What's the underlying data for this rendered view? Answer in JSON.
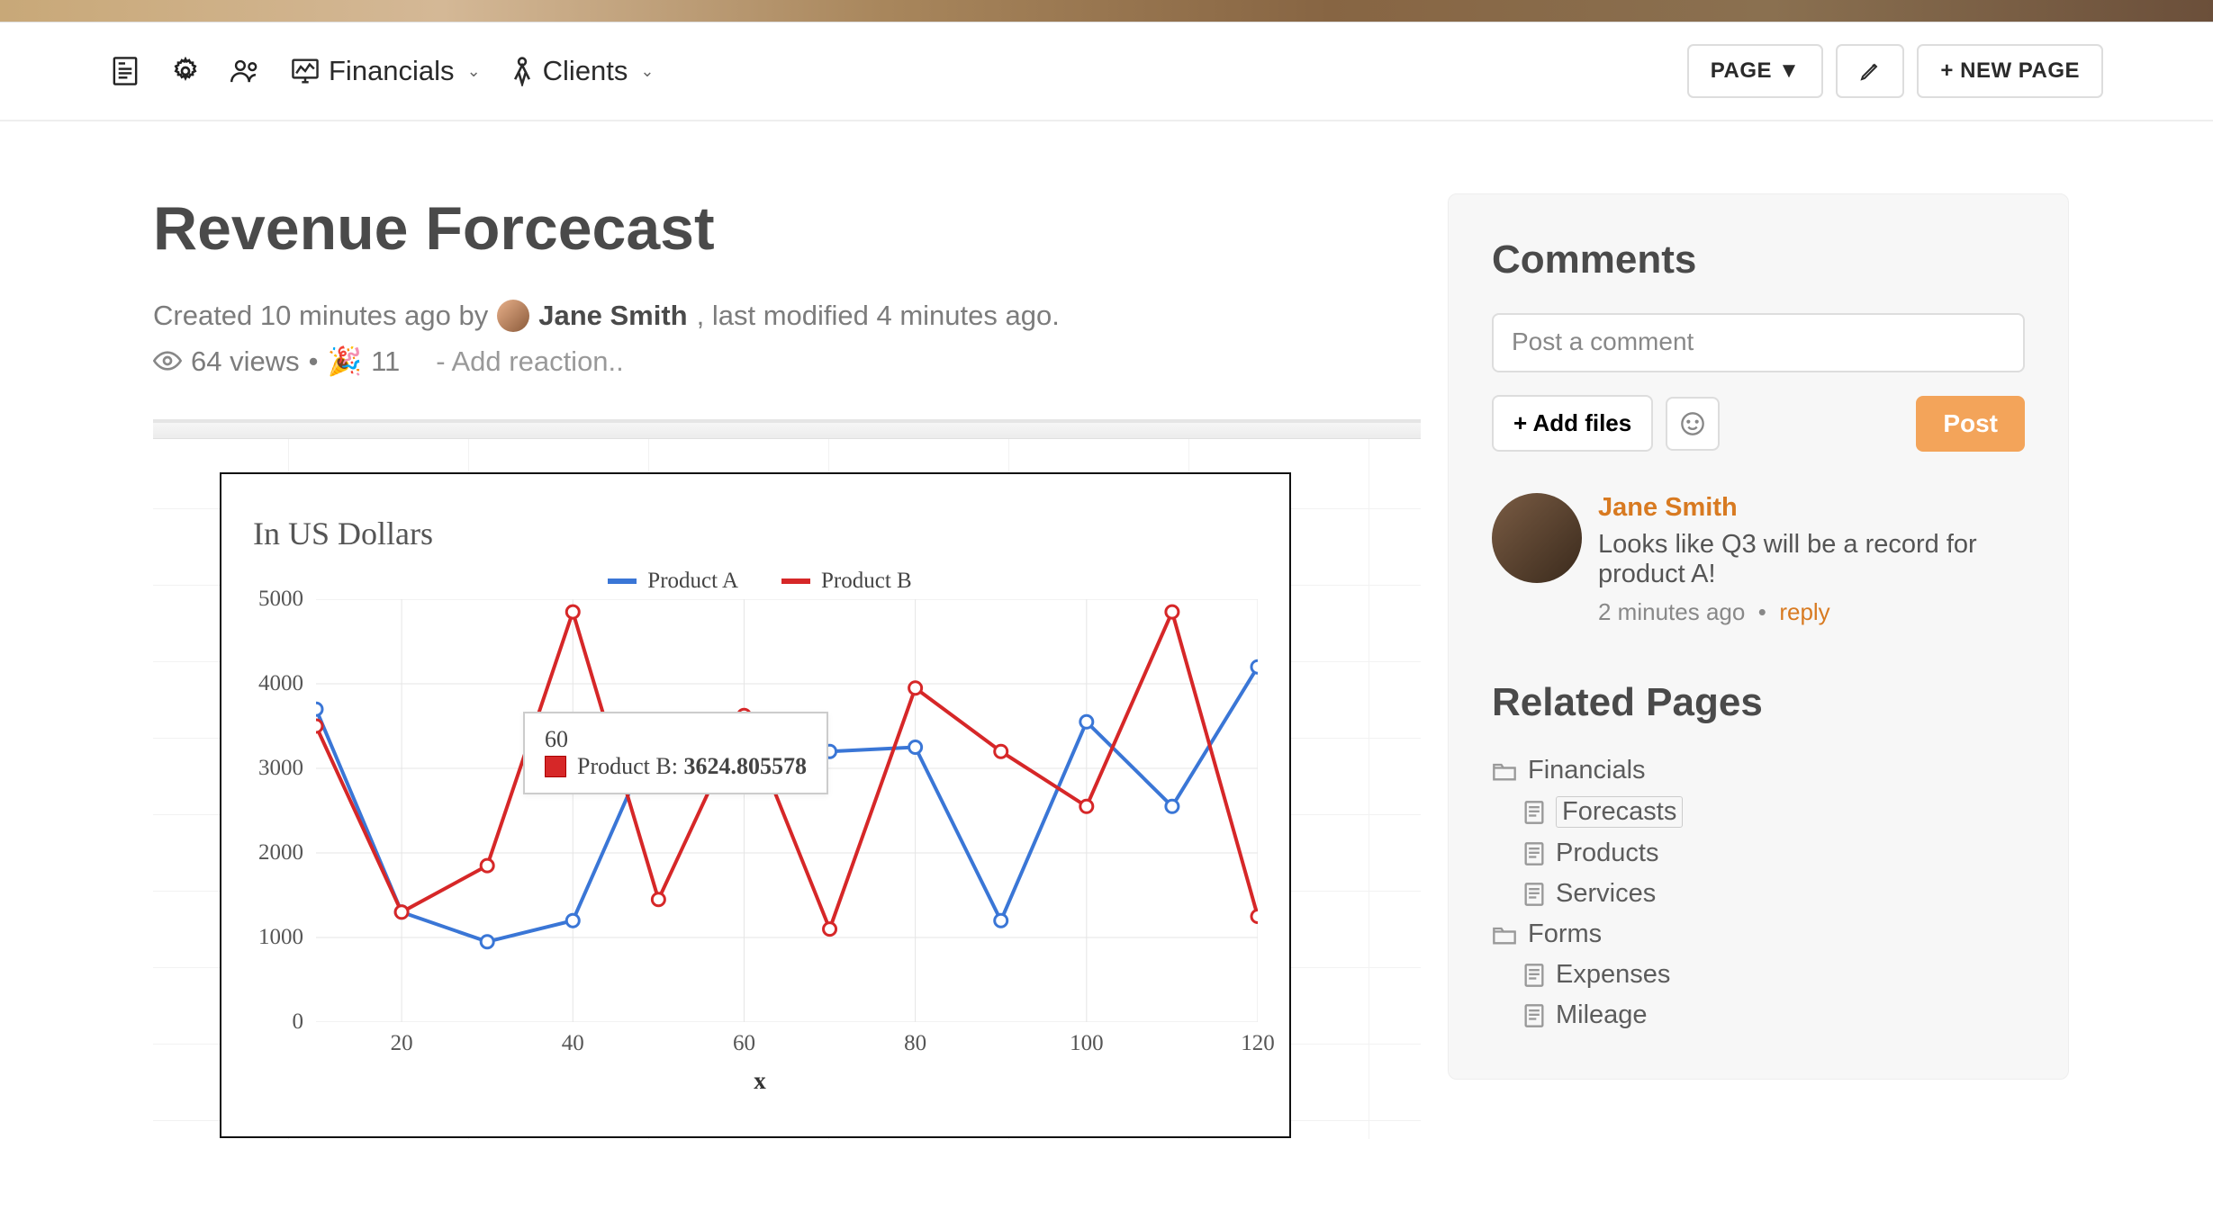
{
  "nav": {
    "financials_label": "Financials",
    "clients_label": "Clients"
  },
  "topbar_buttons": {
    "page_label": "PAGE ▼",
    "new_page_label": "+ NEW PAGE"
  },
  "doc": {
    "title": "Revenue Forcecast",
    "meta_prefix": "Created 10 minutes ago by ",
    "author": "Jane Smith",
    "meta_suffix": ", last modified 4 minutes ago.",
    "views_text": "64 views",
    "bullet": "•",
    "reaction_emoji": "🎉",
    "reaction_count": "11",
    "add_reaction_text": "-  Add reaction.."
  },
  "chart_data": {
    "type": "line",
    "title": "In US Dollars",
    "xlabel": "x",
    "ylabel": "",
    "xlim": [
      10,
      120
    ],
    "ylim": [
      0,
      5000
    ],
    "xticks": [
      20,
      40,
      60,
      80,
      100,
      120
    ],
    "yticks": [
      0,
      1000,
      2000,
      3000,
      4000,
      5000
    ],
    "series": [
      {
        "name": "Product A",
        "color": "#3a76d6",
        "x": [
          10,
          20,
          30,
          40,
          50,
          60,
          70,
          80,
          90,
          100,
          110,
          120
        ],
        "y": [
          3700,
          1300,
          950,
          1200,
          3500,
          3100,
          3200,
          3250,
          1200,
          3550,
          2550,
          4200
        ]
      },
      {
        "name": "Product B",
        "color": "#d62728",
        "x": [
          10,
          20,
          30,
          40,
          50,
          60,
          70,
          80,
          90,
          100,
          110,
          120
        ],
        "y": [
          3500,
          1300,
          1850,
          4850,
          1450,
          3625,
          1100,
          3950,
          3200,
          2550,
          4850,
          1250
        ]
      }
    ],
    "tooltip": {
      "x_label": "60",
      "series": "Product B",
      "value": "3624.805578"
    }
  },
  "comments": {
    "heading": "Comments",
    "placeholder": "Post a comment",
    "add_files_label": "+ Add files",
    "post_label": "Post",
    "items": [
      {
        "author": "Jane Smith",
        "text": "Looks like Q3 will be a record for product A!",
        "time": "2 minutes ago",
        "reply_label": "reply"
      }
    ]
  },
  "related": {
    "heading": "Related Pages",
    "tree": [
      {
        "type": "folder",
        "label": "Financials",
        "children": [
          {
            "type": "page",
            "label": "Forecasts",
            "active": true
          },
          {
            "type": "page",
            "label": "Products"
          },
          {
            "type": "page",
            "label": "Services"
          }
        ]
      },
      {
        "type": "folder",
        "label": "Forms",
        "children": [
          {
            "type": "page",
            "label": "Expenses"
          },
          {
            "type": "page",
            "label": "Mileage"
          }
        ]
      }
    ]
  }
}
